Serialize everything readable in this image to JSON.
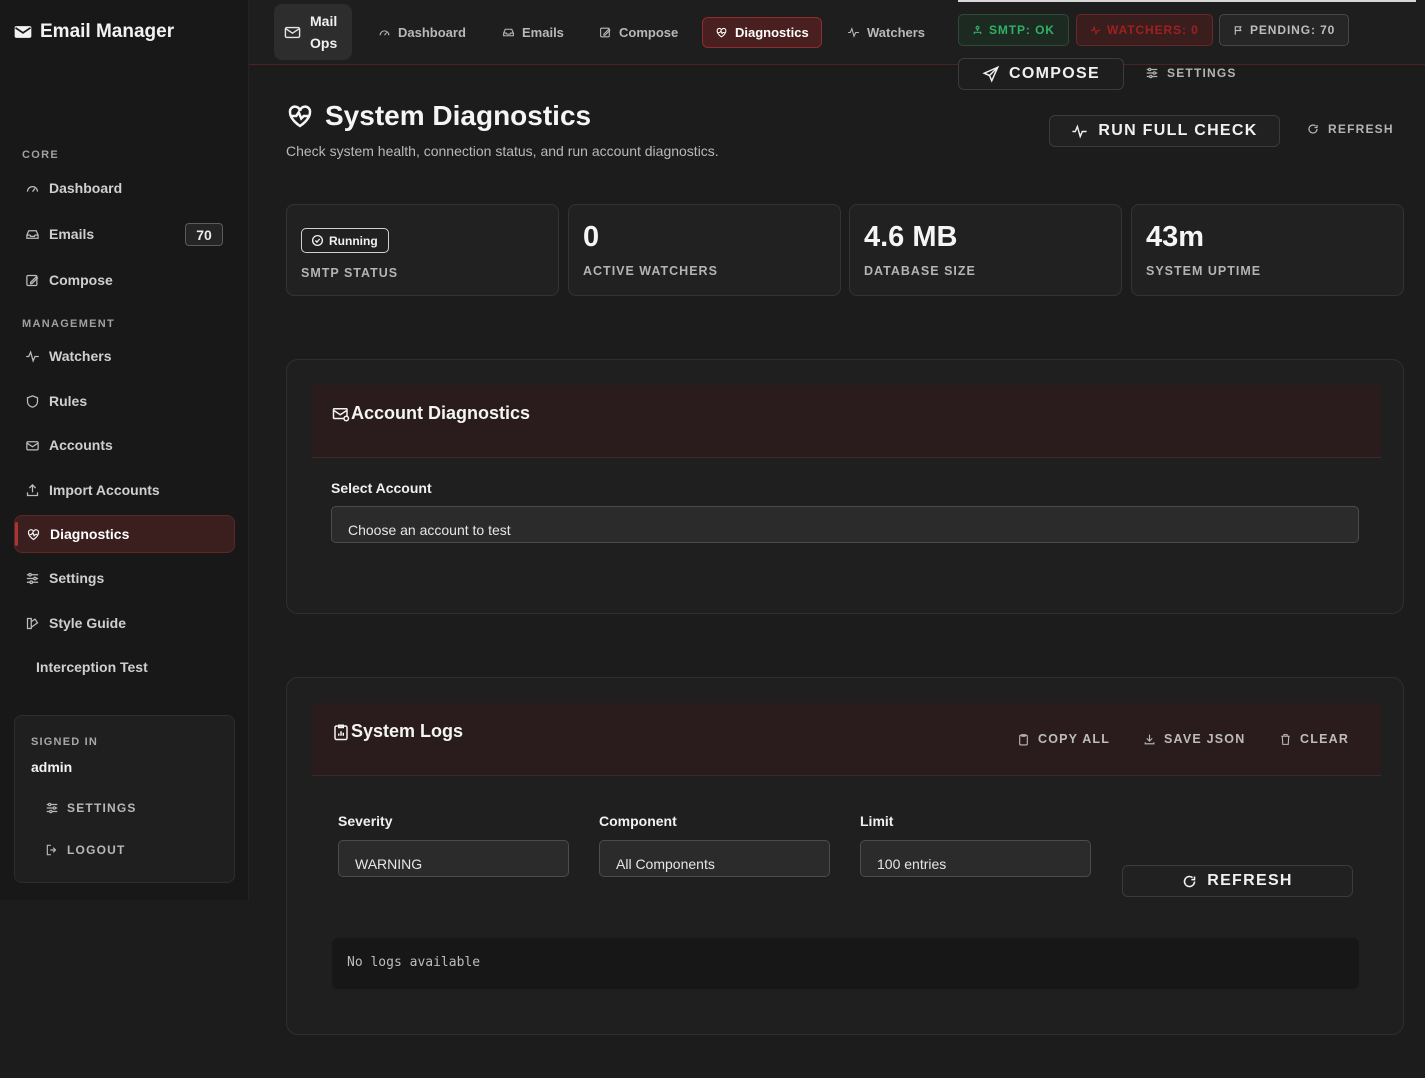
{
  "app": {
    "brand": "Email Manager"
  },
  "sidebar": {
    "sections": [
      {
        "label": "CORE"
      },
      {
        "label": "MANAGEMENT"
      }
    ],
    "items": [
      {
        "label": "Dashboard",
        "icon": "gauge-icon"
      },
      {
        "label": "Emails",
        "icon": "inbox-icon",
        "badge": "70"
      },
      {
        "label": "Compose",
        "icon": "edit-icon"
      },
      {
        "label": "Watchers",
        "icon": "activity-icon"
      },
      {
        "label": "Rules",
        "icon": "shield-icon"
      },
      {
        "label": "Accounts",
        "icon": "mail-stack-icon"
      },
      {
        "label": "Import Accounts",
        "icon": "upload-icon"
      },
      {
        "label": "Diagnostics",
        "icon": "heart-pulse-icon",
        "active": true
      },
      {
        "label": "Settings",
        "icon": "sliders-icon"
      },
      {
        "label": "Style Guide",
        "icon": "palette-icon"
      },
      {
        "label": "Interception Test"
      }
    ],
    "signin": {
      "label": "SIGNED IN",
      "user": "admin",
      "settings": "SETTINGS",
      "logout": "LOGOUT"
    }
  },
  "topbar": {
    "brand_line1": "Mail",
    "brand_line2": "Ops",
    "nav": [
      {
        "label": "Dashboard"
      },
      {
        "label": "Emails"
      },
      {
        "label": "Compose"
      },
      {
        "label": "Diagnostics",
        "active": true
      },
      {
        "label": "Watchers"
      }
    ],
    "status": {
      "smtp": "SMTP: OK",
      "watchers": "WATCHERS: 0",
      "pending": "PENDING: 70"
    },
    "compose": "COMPOSE",
    "settings": "SETTINGS"
  },
  "page": {
    "title": "System Diagnostics",
    "subtitle": "Check system health, connection status, and run account diagnostics.",
    "run_full_check": "RUN FULL CHECK",
    "refresh": "REFRESH"
  },
  "stats": [
    {
      "badge": "Running",
      "label": "SMTP STATUS"
    },
    {
      "value": "0",
      "label": "ACTIVE WATCHERS"
    },
    {
      "value": "4.6 MB",
      "label": "DATABASE SIZE"
    },
    {
      "value": "43m",
      "label": "SYSTEM UPTIME"
    }
  ],
  "account_diag": {
    "title": "Account Diagnostics",
    "select_label": "Select Account",
    "select_value": "Choose an account to test"
  },
  "logs": {
    "title": "System Logs",
    "copy_all": "COPY ALL",
    "save_json": "SAVE JSON",
    "clear": "CLEAR",
    "severity_label": "Severity",
    "severity_value": "WARNING",
    "component_label": "Component",
    "component_value": "All Components",
    "limit_label": "Limit",
    "limit_value": "100 entries",
    "refresh": "REFRESH",
    "empty": "No logs available"
  },
  "colors": {
    "accent": "#8a2e2e",
    "ok": "#2fb065",
    "error": "#9c2222"
  }
}
